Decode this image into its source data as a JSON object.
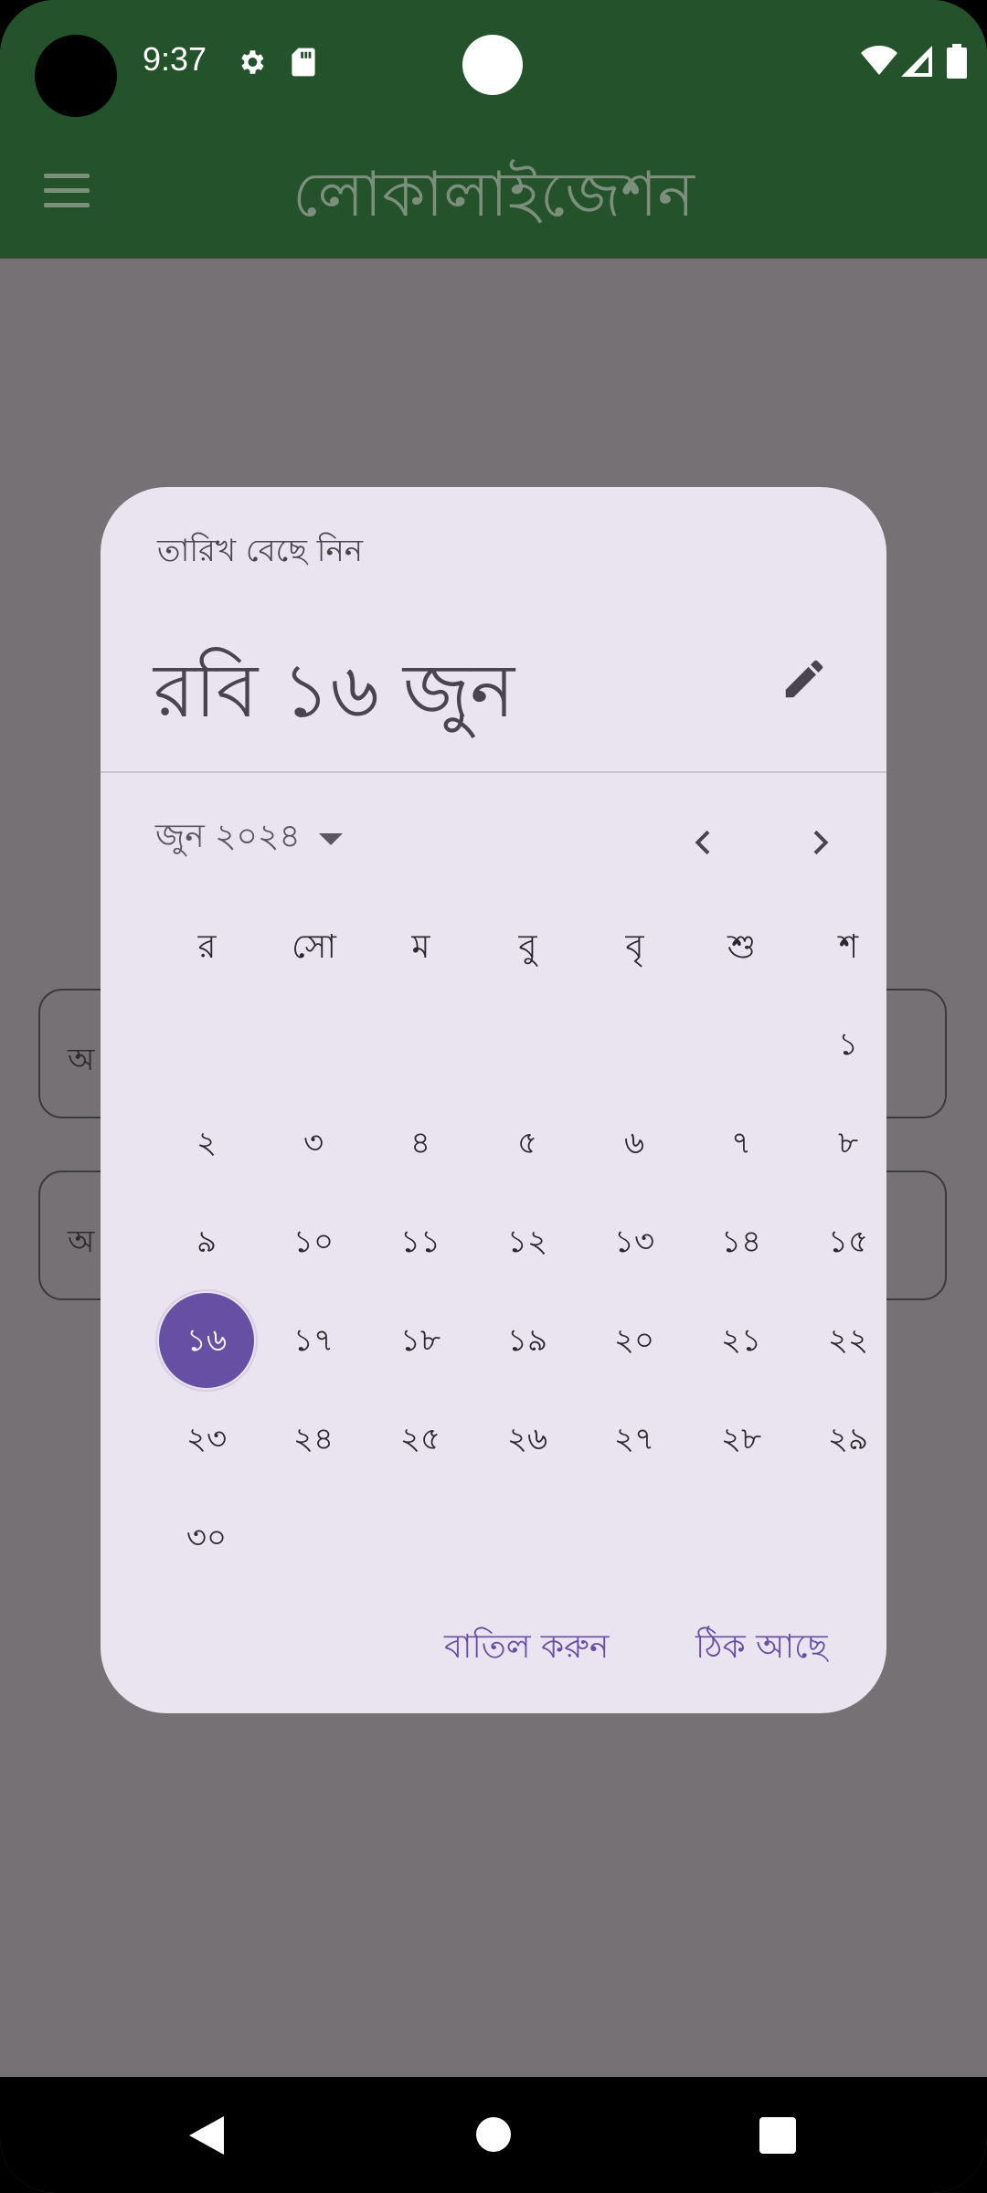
{
  "status_bar": {
    "time": "9:37",
    "icons": [
      "settings-icon",
      "sd-card-icon",
      "wifi-icon",
      "signal-icon",
      "battery-icon"
    ]
  },
  "app_bar": {
    "title": "লোকালাইজেশন",
    "menu_icon": "hamburger-menu-icon"
  },
  "background_fields": [
    {
      "label": "অ"
    },
    {
      "label": "অ"
    }
  ],
  "date_picker": {
    "heading": "তারিখ বেছে নিন",
    "selected_date_text": "রবি ১৬ জুন",
    "month_year": "জুন ২০২৪",
    "weekdays": [
      "র",
      "সো",
      "ম",
      "বু",
      "বৃ",
      "শু",
      "শ"
    ],
    "first_day_column": 6,
    "days": [
      "১",
      "২",
      "৩",
      "৪",
      "৫",
      "৬",
      "৭",
      "৮",
      "৯",
      "১০",
      "১১",
      "১২",
      "১৩",
      "১৪",
      "১৫",
      "১৬",
      "১৭",
      "১৮",
      "১৯",
      "২০",
      "২১",
      "২২",
      "২৩",
      "২৪",
      "২৫",
      "২৬",
      "২৭",
      "২৮",
      "২৯",
      "৩০"
    ],
    "selected_day": 16,
    "cancel_label": "বাতিল করুন",
    "ok_label": "ঠিক আছে"
  },
  "colors": {
    "app_bar": "#24522a",
    "scrim": "#757174",
    "dialog_bg": "#e9e4ef",
    "accent": "#6750a4"
  }
}
